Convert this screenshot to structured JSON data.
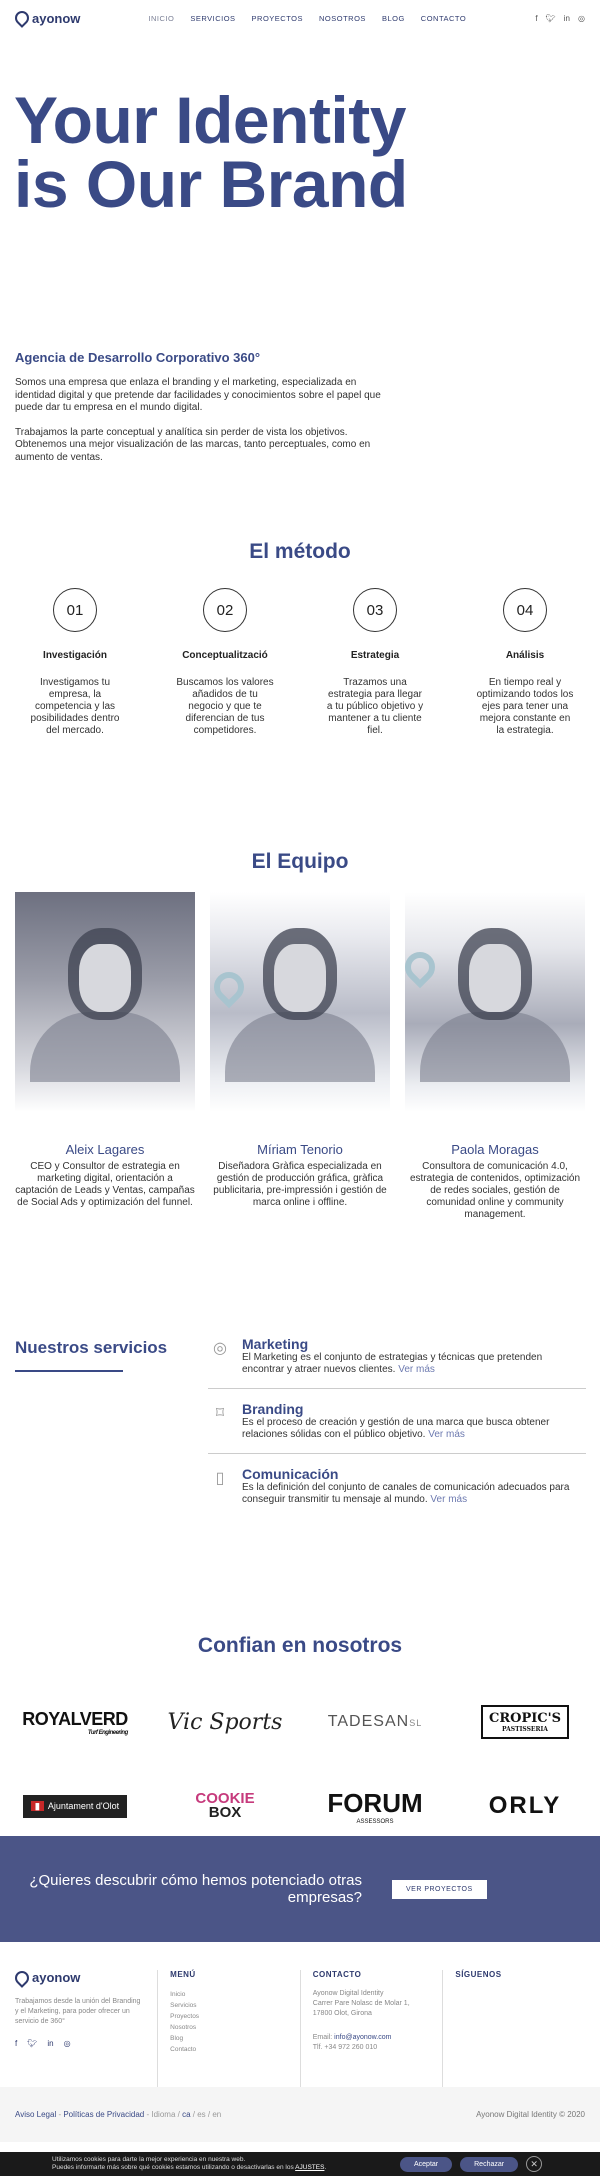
{
  "nav": {
    "brand": "ayonow",
    "items": [
      "INICIO",
      "SERVICIOS",
      "PROYECTOS",
      "NOSOTROS",
      "BLOG",
      "CONTACTO"
    ],
    "active": "INICIO",
    "social_icons": [
      "facebook-icon",
      "twitter-icon",
      "linkedin-icon",
      "instagram-icon"
    ]
  },
  "hero": {
    "line1": "Your Identity",
    "line2": "is Our Brand"
  },
  "intro": {
    "title": "Agencia de Desarrollo Corporativo 360°",
    "p1": "Somos una empresa que enlaza el branding y el marketing, especializada en identidad digital y que pretende dar facilidades y conocimientos sobre el papel que puede dar tu empresa en el mundo digital.",
    "p2": "Trabajamos la parte conceptual y analítica sin perder de vista los objetivos. Obtenemos una mejor visualización de las marcas, tanto perceptuales, como en aumento de ventas."
  },
  "method": {
    "title": "El método",
    "steps": [
      {
        "num": "01",
        "title": "Investigación",
        "text": "Investigamos tu empresa, la competencia y las posibilidades dentro del mercado."
      },
      {
        "num": "02",
        "title": "Conceptualització",
        "text": "Buscamos los valores añadidos de tu negocio y que te diferencian de tus competidores."
      },
      {
        "num": "03",
        "title": "Estrategia",
        "text": "Trazamos una estrategia para llegar a tu público objetivo y mantener a tu cliente fiel."
      },
      {
        "num": "04",
        "title": "Análisis",
        "text": "En tiempo real y optimizando todos los ejes para tener una mejora constante en la estrategia."
      }
    ]
  },
  "team": {
    "title": "El Equipo",
    "members": [
      {
        "name": "Aleix Lagares",
        "role": "CEO y Consultor de estrategia en marketing digital, orientación a captación de Leads y Ventas, campañas de Social Ads y optimización del funnel."
      },
      {
        "name": "Míriam Tenorio",
        "role": "Diseñadora Gràfica especializada en gestión de producción gráfica, gràfica publicitaria, pre-impressión i gestión de marca online i offline."
      },
      {
        "name": "Paola Moragas",
        "role": "Consultora de comunicación 4.0, estrategia de contenidos, optimización de redes sociales, gestión de comunidad online y community management."
      }
    ]
  },
  "services": {
    "title": "Nuestros servicios",
    "items": [
      {
        "icon": "target-icon",
        "name": "Marketing",
        "text": "El Marketing es el conjunto de estrategias y técnicas que pretenden encontrar y atraer nuevos clientes.",
        "more": "Ver más"
      },
      {
        "icon": "tag-icon",
        "name": "Branding",
        "text": "Es el proceso de creación y gestión de una marca que busca obtener relaciones sólidas con el público objetivo.",
        "more": "Ver más"
      },
      {
        "icon": "document-icon",
        "name": "Comunicación",
        "text": "Es la definición del conjunto de canales de comunicación adecuados para conseguir transmitir tu mensaje al mundo.",
        "more": "Ver más"
      }
    ]
  },
  "clients": {
    "title": "Confian en nosotros",
    "royalverd": "ROYALVERD",
    "royalverd_sub": "Turf Engineering",
    "vic": "Vic Sports",
    "tadesan": "TADESAN",
    "tadesan_sub": "SL",
    "cropics": "CROPIC'S",
    "cropics_sub": "PASTISSERIA",
    "olot": "Ajuntament d'Olot",
    "cookie1": "COOKIE",
    "cookie2": "BOX",
    "forum": "FORUM",
    "forum_sub": "ASSESSORS",
    "orly": "ORLY"
  },
  "cta": {
    "text": "¿Quieres descubrir cómo hemos potenciado otras empresas?",
    "button": "VER PROYECTOS"
  },
  "footer": {
    "brand": "ayonow",
    "about": "Trabajamos desde la unión del Branding y el Marketing, para poder ofrecer un servicio de 360°",
    "menu_title": "MENÚ",
    "menu": [
      "Inicio",
      "Servicios",
      "Proyectos",
      "Nosotros",
      "Blog",
      "Contacto"
    ],
    "contact_title": "CONTACTO",
    "address1": "Ayonow Digital Identity",
    "address2": "Carrer Pare Nolasc de Molar 1,",
    "address3": "17800 Olot, Girona",
    "email_label": "Email:",
    "email": "info@ayonow.com",
    "phone": "Tlf. +34 972 260 010",
    "follow_title": "SÍGUENOS"
  },
  "bottom": {
    "legal": "Aviso Legal",
    "privacy": "Políticas de Privacidad",
    "idioma": "Idioma",
    "lang_ca": "ca",
    "lang_es": "es",
    "lang_en": "en",
    "copyright": "Ayonow Digital Identity © 2020"
  },
  "cookie": {
    "line1": "Utilizamos cookies para darte la mejor experiencia en nuestra web.",
    "line2": "Puedes informarte más sobre qué cookies estamos utilizando o desactivarlas en los",
    "link": "AJUSTES",
    "accept": "Aceptar",
    "reject": "Rechazar",
    "close": "✕"
  },
  "colors": {
    "brand_navy": "#3a4a86",
    "cta_band": "#4b5587"
  }
}
